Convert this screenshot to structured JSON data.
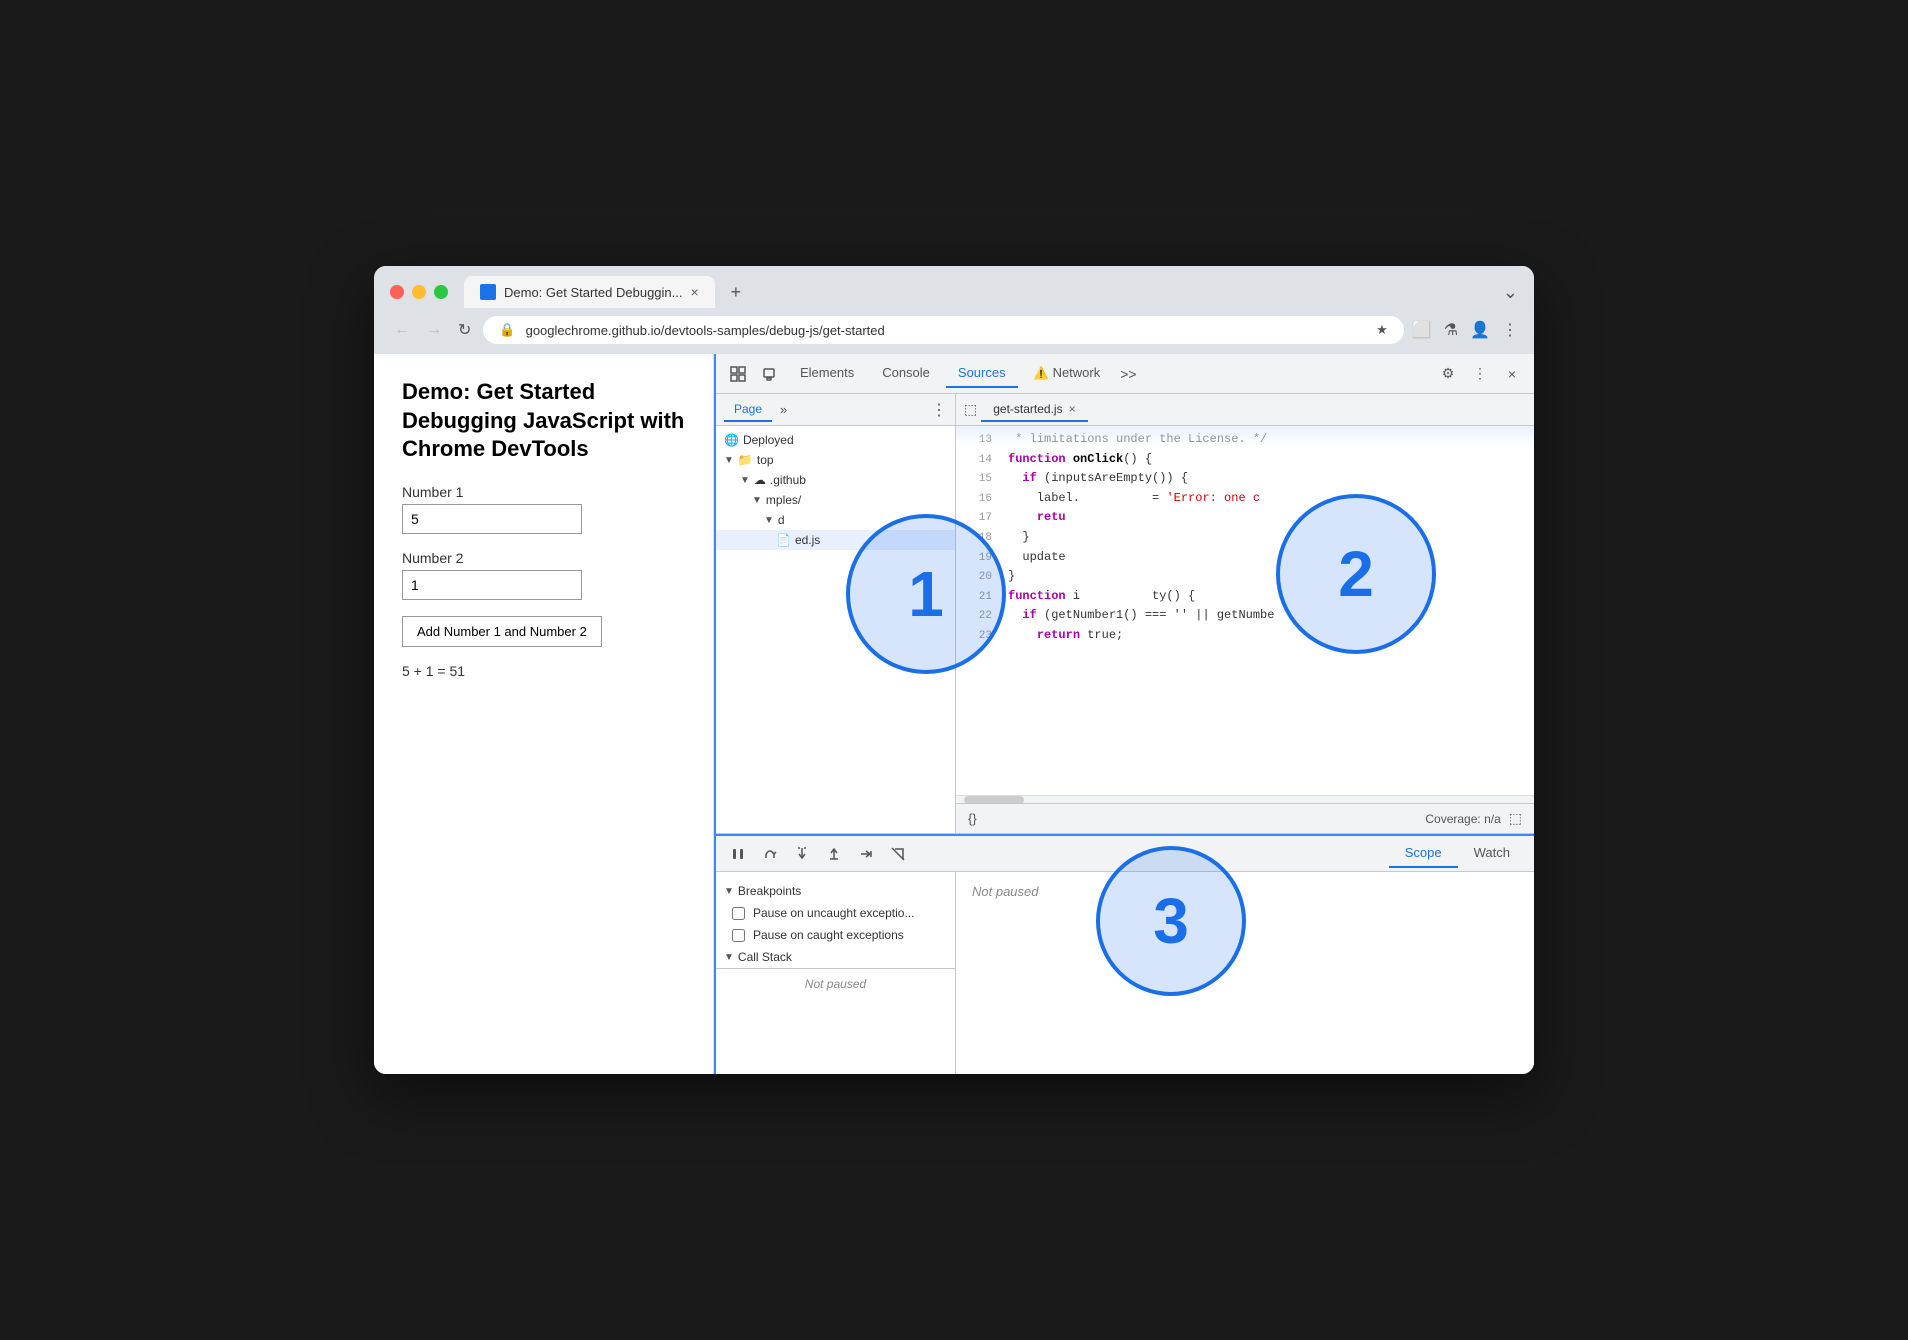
{
  "browser": {
    "tab_title": "Demo: Get Started Debuggin...",
    "tab_close": "×",
    "tab_new": "+",
    "tab_menu": "⌄",
    "url": "googlechrome.github.io/devtools-samples/debug-js/get-started",
    "nav_back": "←",
    "nav_forward": "→",
    "nav_reload": "↻"
  },
  "page": {
    "title": "Demo: Get Started Debugging JavaScript with Chrome DevTools",
    "label1": "Number 1",
    "input1_value": "5",
    "label2": "Number 2",
    "input2_value": "1",
    "button_label": "Add Number 1 and Number 2",
    "result": "5 + 1 = 51"
  },
  "devtools": {
    "tabs": [
      "Elements",
      "Console",
      "Sources",
      "Network"
    ],
    "active_tab": "Sources",
    "settings_icon": "⚙",
    "more_icon": "⋮",
    "close_icon": "×",
    "inspect_icon": "⬚",
    "device_icon": "▭"
  },
  "sources": {
    "file_tree_tab": "Page",
    "file_tree_more": "»",
    "deployed_label": "Deployed",
    "top_label": "top",
    "github_partial": ".github",
    "samples_partial": "mples/",
    "file_partial": "d",
    "file_selected": "ed.js",
    "editor_tab": "get-started.js",
    "coverage_label": "Coverage: n/a"
  },
  "code": {
    "lines": [
      {
        "num": "13",
        "text": " * limitations under the License. */",
        "type": "comment"
      },
      {
        "num": "14",
        "text": "function onClick() {",
        "type": "code"
      },
      {
        "num": "15",
        "text": "  if (inputsAreEmpty()) {",
        "type": "code"
      },
      {
        "num": "16",
        "text": "    label.          = 'Error: one c",
        "type": "code"
      },
      {
        "num": "17",
        "text": "    retu",
        "type": "code"
      },
      {
        "num": "18",
        "text": "  }",
        "type": "code"
      },
      {
        "num": "19",
        "text": "  update",
        "type": "code"
      },
      {
        "num": "20",
        "text": "}",
        "type": "code"
      },
      {
        "num": "21",
        "text": "function i          ty() {",
        "type": "code"
      },
      {
        "num": "22",
        "text": "  if (getNumber1() === '' || getNumbe",
        "type": "code"
      },
      {
        "num": "23",
        "text": "    return true;",
        "type": "code"
      }
    ]
  },
  "debugger": {
    "pause_btn": "⏸",
    "step_over": "↩",
    "step_into": "↓",
    "step_out": "↑",
    "deactivate": "⇥",
    "disable_btn": "⊘",
    "scope_tab": "Scope",
    "watch_tab": "Watch",
    "breakpoints_label": "Breakpoints",
    "pause_uncaught": "Pause on uncaught exceptio...",
    "pause_caught": "Pause on caught exceptions",
    "call_stack_label": "Call Stack",
    "not_paused_right": "Not paused",
    "not_paused_bottom": "Not paused"
  },
  "annotations": [
    {
      "id": "1",
      "label": "1"
    },
    {
      "id": "2",
      "label": "2"
    },
    {
      "id": "3",
      "label": "3"
    }
  ]
}
